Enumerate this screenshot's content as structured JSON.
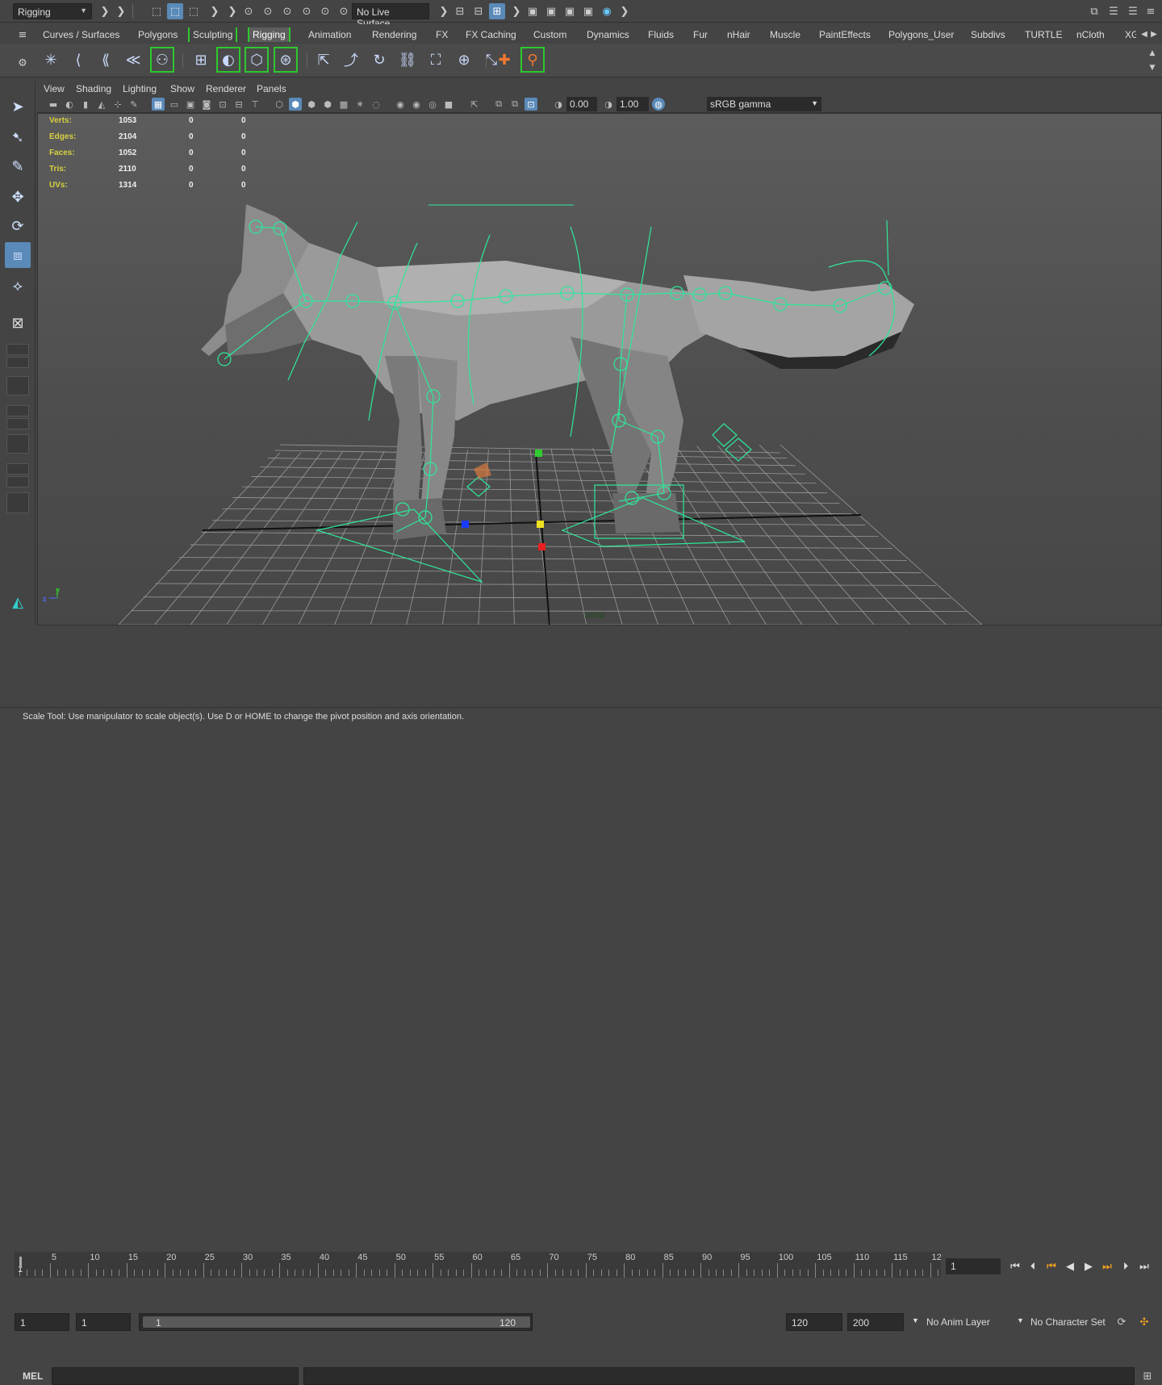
{
  "status_line": {
    "menu_set": "Rigging",
    "live_surface": "No Live Surface"
  },
  "shelf_tabs": [
    "Curves / Surfaces",
    "Polygons",
    "Sculpting",
    "Rigging",
    "Animation",
    "Rendering",
    "FX",
    "FX Caching",
    "Custom",
    "Dynamics",
    "Fluids",
    "Fur",
    "nHair",
    "Muscle",
    "PaintEffects",
    "Polygons_User",
    "Subdivs",
    "TURTLE",
    "nCloth",
    "XG"
  ],
  "active_shelf_tab": "Rigging",
  "panel_menu": [
    "View",
    "Shading",
    "Lighting",
    "Show",
    "Renderer",
    "Panels"
  ],
  "panel_toolbar": {
    "exposure": "0.00",
    "gamma": "1.00",
    "color_space": "sRGB gamma"
  },
  "hud": {
    "rows": [
      {
        "label": "Verts:",
        "a": "1053",
        "b": "0",
        "c": "0"
      },
      {
        "label": "Edges:",
        "a": "2104",
        "b": "0",
        "c": "0"
      },
      {
        "label": "Faces:",
        "a": "1052",
        "b": "0",
        "c": "0"
      },
      {
        "label": "Tris:",
        "a": "2110",
        "b": "0",
        "c": "0"
      },
      {
        "label": "UVs:",
        "a": "1314",
        "b": "0",
        "c": "0"
      }
    ],
    "camera": "persp"
  },
  "timeline": {
    "ticks": [
      "5",
      "10",
      "15",
      "20",
      "25",
      "30",
      "35",
      "40",
      "45",
      "50",
      "55",
      "60",
      "65",
      "70",
      "75",
      "80",
      "85",
      "90",
      "95",
      "100",
      "105",
      "110",
      "115",
      "12"
    ],
    "start_marker": "1",
    "current_frame": "1"
  },
  "range": {
    "start": "1",
    "playback_start": "1",
    "slider_start": "1",
    "slider_end": "120",
    "playback_end": "120",
    "end": "200",
    "anim_layer": "No Anim Layer",
    "character_set": "No Character Set"
  },
  "command_line": {
    "language": "MEL"
  },
  "help_line": "Scale Tool: Use manipulator to scale object(s). Use D or HOME to change the pivot position and axis orientation.",
  "colors": {
    "accent": "#5a8ab8",
    "joint": "#2ee89a",
    "active_tab_border": "#2ec82e"
  }
}
